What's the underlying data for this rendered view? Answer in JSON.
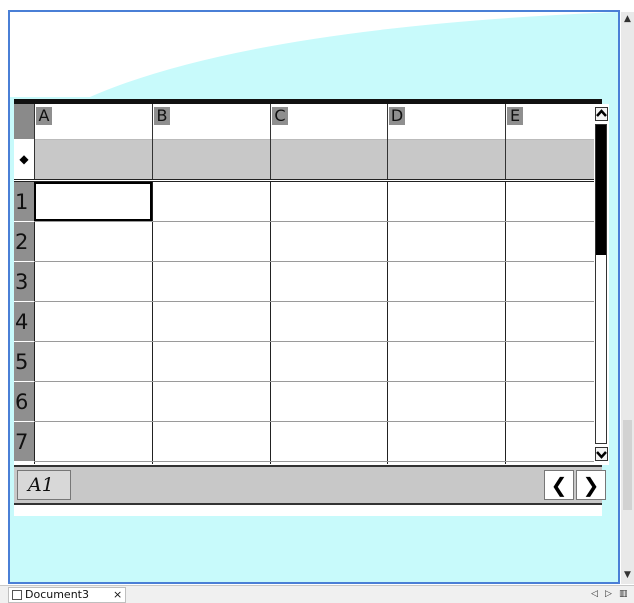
{
  "spreadsheet": {
    "columns": [
      "A",
      "B",
      "C",
      "D",
      "E"
    ],
    "formula_row_marker": "◆",
    "rows": [
      "1",
      "2",
      "3",
      "4",
      "5",
      "6",
      "7"
    ],
    "active_cell_ref": "A1",
    "scroll_left_label": "❮",
    "scroll_right_label": "❯"
  },
  "tabs": [
    {
      "label": "Document3",
      "close_label": "×"
    }
  ],
  "nav": {
    "prev": "◁",
    "next": "▷",
    "menu": "▥"
  },
  "colors": {
    "frame_border": "#4a7fd6",
    "background_shape": "#c8fafb",
    "header_gray": "#8f8f8f",
    "formula_row": "#c8c8c8"
  }
}
